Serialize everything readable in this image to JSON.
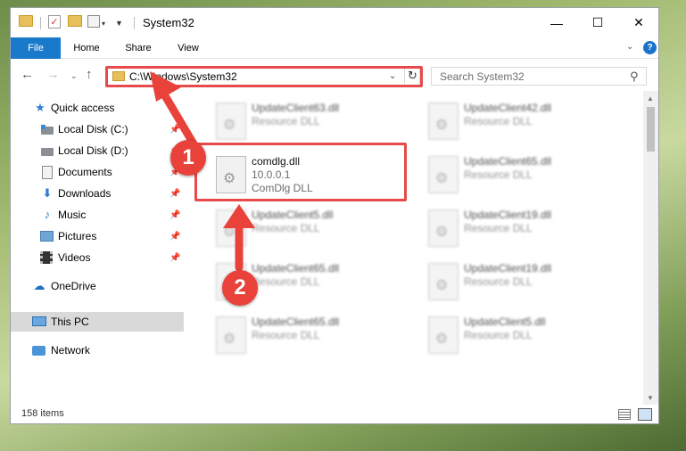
{
  "window": {
    "title": "System32",
    "controls": {
      "minimize": "—",
      "maximize": "☐",
      "close": "✕"
    }
  },
  "quick_access_toolbar": {
    "check": "✓",
    "dropdown": "▾",
    "customize": "▼"
  },
  "ribbon": {
    "tabs": [
      "File",
      "Home",
      "Share",
      "View"
    ],
    "expand": "⌄",
    "help": "?"
  },
  "navigation": {
    "back": "←",
    "forward": "→",
    "recent": "⌄",
    "up": "↑",
    "address": "C:\\Windows\\System32",
    "address_dropdown": "⌄",
    "refresh": "↻",
    "search_placeholder": "Search System32"
  },
  "nav_pane": {
    "items": [
      {
        "label": "Quick access",
        "icon": "star-icon",
        "pinned": false
      },
      {
        "label": "Local Disk (C:)",
        "icon": "drive-icon",
        "pinned": true
      },
      {
        "label": "Local Disk (D:)",
        "icon": "drive-icon",
        "pinned": true
      },
      {
        "label": "Documents",
        "icon": "documents-icon",
        "pinned": true
      },
      {
        "label": "Downloads",
        "icon": "download-icon",
        "pinned": true
      },
      {
        "label": "Music",
        "icon": "music-icon",
        "pinned": true
      },
      {
        "label": "Pictures",
        "icon": "pictures-icon",
        "pinned": true
      },
      {
        "label": "Videos",
        "icon": "videos-icon",
        "pinned": true
      },
      {
        "label": "OneDrive",
        "icon": "cloud-icon",
        "pinned": false
      },
      {
        "label": "This PC",
        "icon": "computer-icon",
        "pinned": false,
        "selected": true
      },
      {
        "label": "Network",
        "icon": "network-icon",
        "pinned": false
      }
    ],
    "pin_glyph": "📌"
  },
  "files": {
    "left": [
      {
        "name": "UpdateClient63.dll",
        "line2": "Resource DLL"
      },
      {
        "name": "comdlg.dll",
        "line2": "10.0.0.1",
        "line3": "ComDlg DLL"
      },
      {
        "name": "UpdateClient5.dll",
        "line2": "Resource DLL"
      },
      {
        "name": "UpdateClient65.dll",
        "line2": "Resource DLL"
      },
      {
        "name": "UpdateClient65.dll",
        "line2": "Resource DLL"
      }
    ],
    "right": [
      {
        "name": "UpdateClient42.dll",
        "line2": "Resource DLL"
      },
      {
        "name": "UpdateClient65.dll",
        "line2": "Resource DLL"
      },
      {
        "name": "UpdateClient19.dll",
        "line2": "Resource DLL"
      },
      {
        "name": "UpdateClient19.dll",
        "line2": "Resource DLL"
      },
      {
        "name": "UpdateClient5.dll",
        "line2": "Resource DLL"
      }
    ]
  },
  "scrollbar": {
    "up": "▲",
    "down": "▼"
  },
  "status": {
    "item_count": "158 items"
  },
  "annotations": {
    "step1": "1",
    "step2": "2",
    "color": "#e8423a"
  },
  "colors": {
    "file_tab": "#1979ca",
    "highlight": "#e64a4a",
    "selected_nav": "#d9d9d9"
  }
}
